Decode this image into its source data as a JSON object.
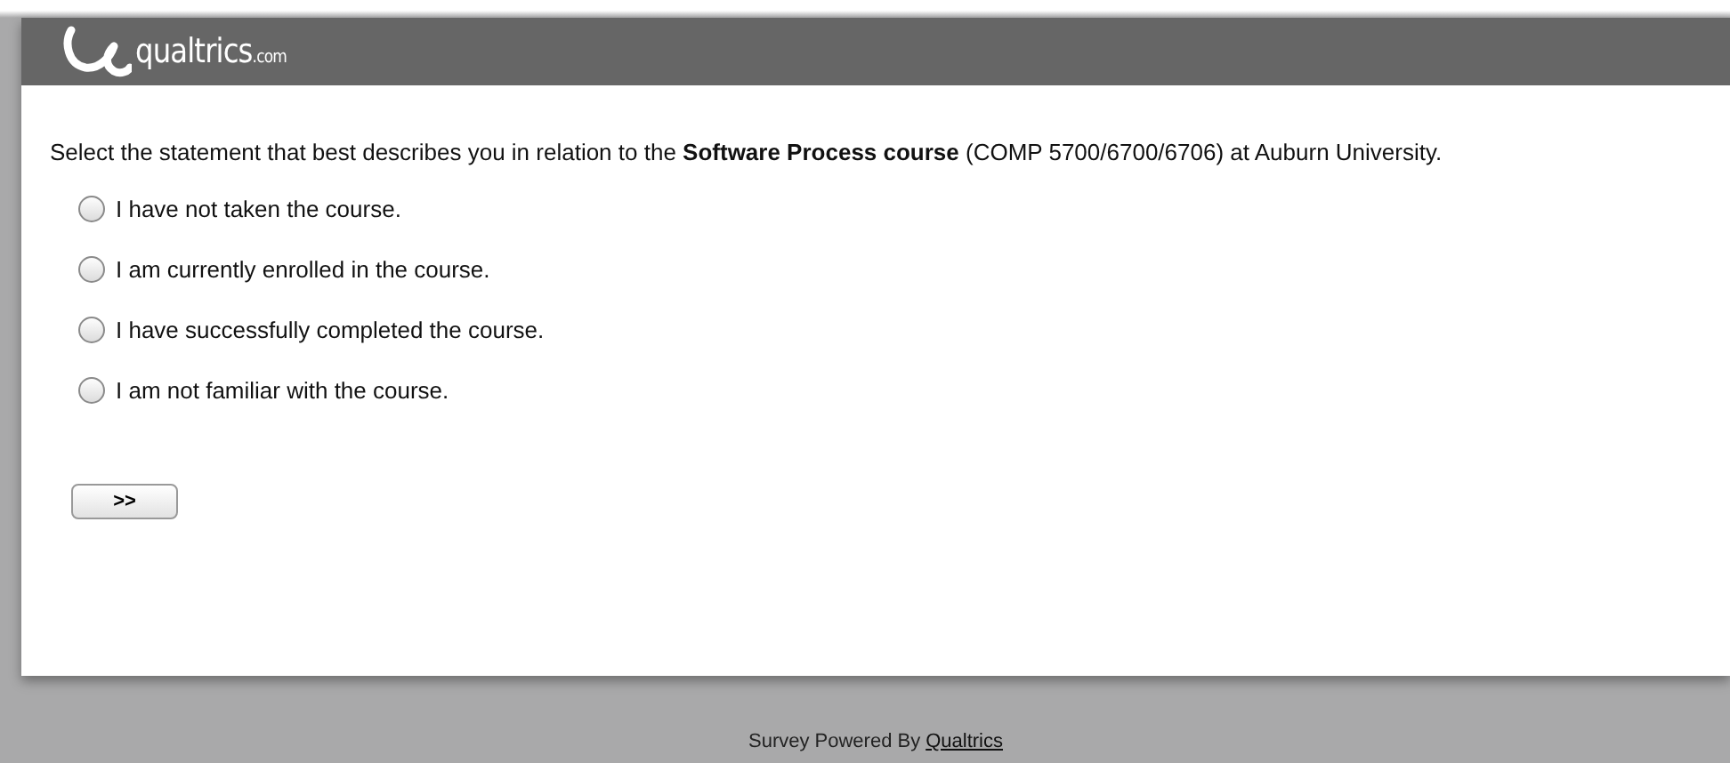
{
  "header": {
    "logo_text": "qualtrics",
    "logo_suffix": ".com"
  },
  "question": {
    "text": "Select the statement that best describes you in relation to the **Software Process course** (COMP 5700/6700/6706) at Auburn University.",
    "options": [
      {
        "label": "I have not taken the course.",
        "selected": false
      },
      {
        "label": "I am currently enrolled in the course.",
        "selected": false
      },
      {
        "label": "I have successfully completed the course.",
        "selected": false
      },
      {
        "label": "I am not familiar with the course.",
        "selected": false
      }
    ]
  },
  "next_button": ">>",
  "footer": {
    "text": "Survey Powered By",
    "link": "Qualtrics"
  }
}
